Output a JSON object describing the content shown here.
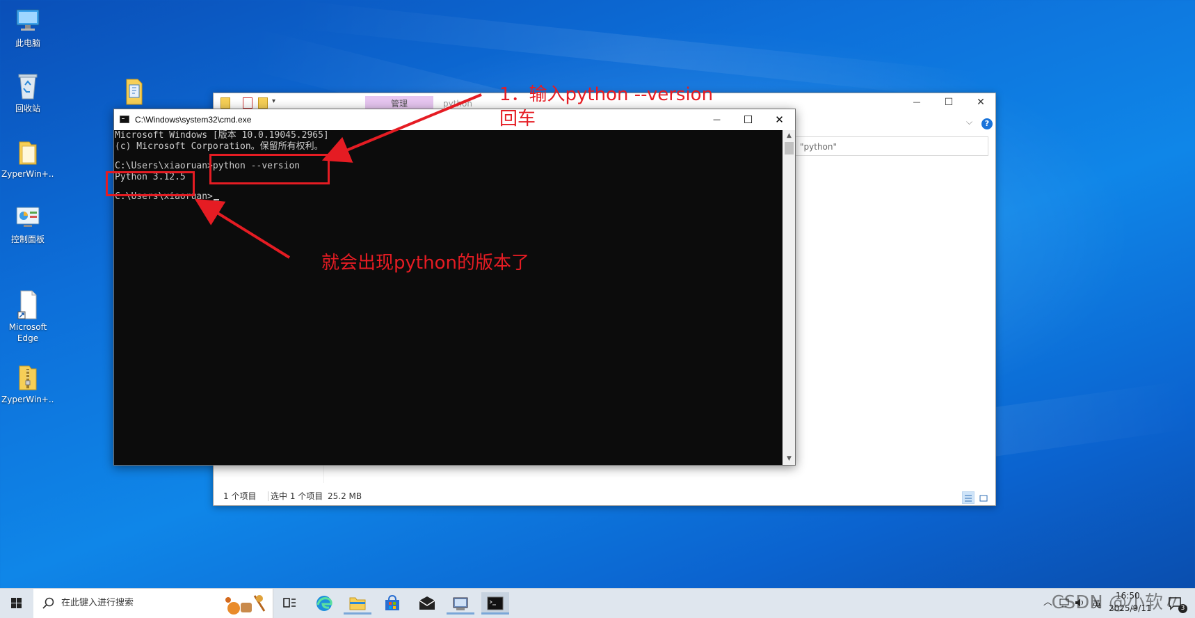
{
  "desktop": {
    "icons": [
      {
        "label": "此电脑",
        "icon": "computer-icon"
      },
      {
        "label": "回收站",
        "icon": "recycle-bin-icon"
      },
      {
        "label": "ZyperWin+...",
        "icon": "folder-icon"
      },
      {
        "label": "控制面板",
        "icon": "control-panel-icon"
      },
      {
        "label": "Microsoft Edge",
        "icon": "shortcut-file-icon"
      },
      {
        "label": "ZyperWin+...",
        "icon": "zip-folder-icon"
      }
    ]
  },
  "explorer": {
    "tab_manage": "管理",
    "tab_python": "python",
    "search_value": "\"python\"",
    "help_label": "?",
    "chevron": "⌵",
    "minimize": "—",
    "maximize": "☐",
    "close": "✕",
    "status_count": "1 个项目",
    "status_selected": "选中 1 个项目",
    "status_size": "25.2 MB"
  },
  "cmd": {
    "title": "C:\\Windows\\system32\\cmd.exe",
    "minimize": "—",
    "maximize": "☐",
    "close": "✕",
    "lines": [
      "Microsoft Windows [版本 10.0.19045.2965]",
      "(c) Microsoft Corporation。保留所有权利。",
      "",
      "C:\\Users\\xiaoruan>python --version",
      "Python 3.12.5",
      "",
      "C:\\Users\\xiaoruan>"
    ],
    "scroll_up": "▲",
    "scroll_down": "▼"
  },
  "annotations": {
    "step1_line1": "1．输入python --version",
    "step1_line2": "回车",
    "result": "就会出现python的版本了",
    "color": "#e51c23"
  },
  "taskbar": {
    "search_placeholder": "在此键入进行搜索",
    "tray_chevron": "︿",
    "ime": "英",
    "time": "16:50",
    "date": "2025/9/11",
    "notification_count": "3"
  },
  "watermark": "CSDN @小软〃"
}
